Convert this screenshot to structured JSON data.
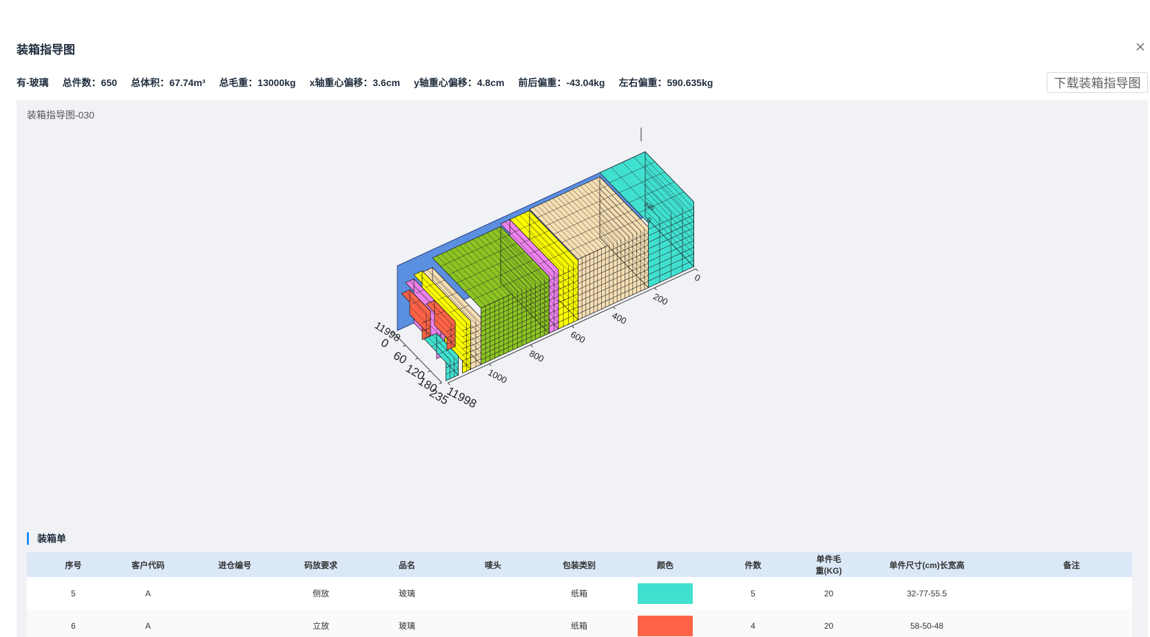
{
  "dialog": {
    "title": "装箱指导图",
    "download_label": "下载装箱指导图"
  },
  "info": {
    "cargo_type": "有-玻璃",
    "total_count": "总件数：650",
    "total_volume": "总体积：67.74m³",
    "total_weight": "总毛重：13000kg",
    "x_offset": "x轴重心偏移：3.6cm",
    "y_offset": "y轴重心偏移：4.8cm",
    "front_back": "前后偏重：-43.04kg",
    "left_right": "左右偏重：590.635kg"
  },
  "chart": {
    "title": "装箱指导图-030",
    "axis_labels": {
      "length_ticks": [
        "0",
        "200",
        "400",
        "600",
        "800",
        "1000",
        "11998"
      ],
      "width_ticks": [
        "0",
        "60",
        "120",
        "180",
        "235"
      ],
      "height_label": "11998",
      "top_ticks": [
        "0",
        "235"
      ]
    },
    "colors": {
      "teal": "#40e0d0",
      "tomato": "#ff6347",
      "yellow": "#ffff00",
      "violet": "#ee82ee",
      "green": "#8bc423",
      "wheat": "#f5deb3",
      "container_blue": "#5b8fe0"
    }
  },
  "packing_list": {
    "title": "装箱单",
    "columns": [
      "序号",
      "客户代码",
      "进仓编号",
      "码放要求",
      "品名",
      "唛头",
      "包装类别",
      "颜色",
      "件数",
      "单件毛重(KG)",
      "单件尺寸(cm)长宽高",
      "备注"
    ],
    "rows": [
      {
        "index": "5",
        "customer": "A",
        "warehouse_no": "",
        "placement": "侧放",
        "name": "玻璃",
        "mark": "",
        "package": "纸箱",
        "color": "#40e0d0",
        "count": "5",
        "weight": "20",
        "size": "32-77-55.5",
        "note": ""
      },
      {
        "index": "6",
        "customer": "A",
        "warehouse_no": "",
        "placement": "立放",
        "name": "玻璃",
        "mark": "",
        "package": "纸箱",
        "color": "#ff6347",
        "count": "4",
        "weight": "20",
        "size": "58-50-48",
        "note": ""
      }
    ]
  }
}
